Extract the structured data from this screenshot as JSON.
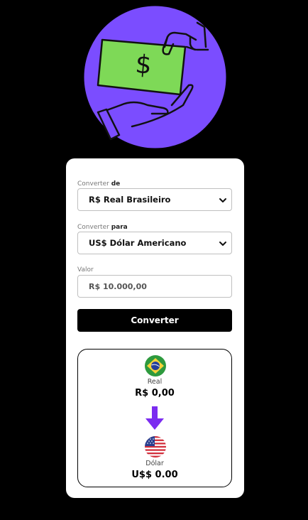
{
  "hero": {
    "illustration": "money-exchange-hands",
    "circle_color": "#7b4dff",
    "bill_color": "#7ed957"
  },
  "form": {
    "from_label_prefix": "Converter",
    "from_label_strong": "de",
    "from_selected": "R$ Real Brasileiro",
    "to_label_prefix": "Converter",
    "to_label_strong": "para",
    "to_selected": "US$ Dólar Americano",
    "value_label": "Valor",
    "value_placeholder": "R$ 10.000,00",
    "submit_label": "Converter"
  },
  "result": {
    "from_currency_name": "Real",
    "from_amount": "R$ 0,00",
    "to_currency_name": "Dólar",
    "to_amount": "U$$ 0.00",
    "from_flag": "brazil-flag-icon",
    "to_flag": "usa-flag-icon",
    "arrow_color": "#7b2cf0"
  }
}
